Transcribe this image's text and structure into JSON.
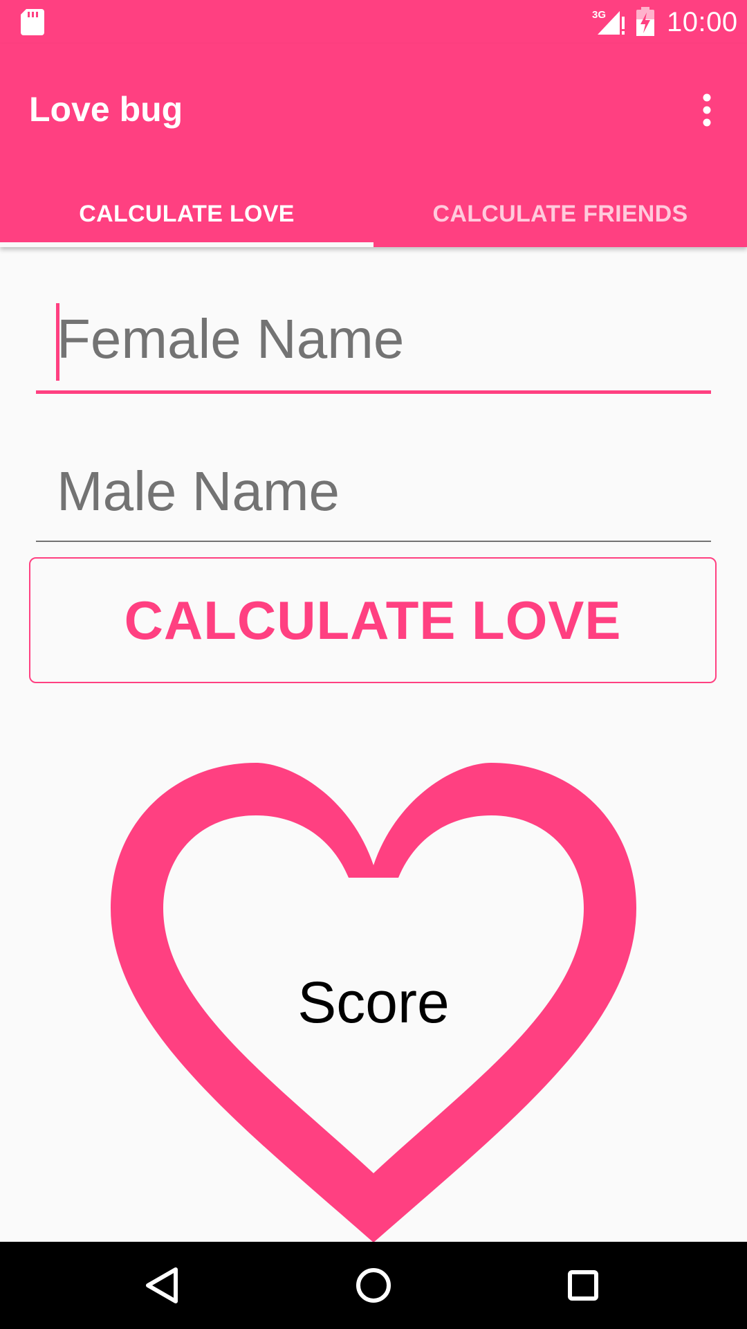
{
  "status_bar": {
    "time": "10:00",
    "network": "3G",
    "icons": [
      "sd-card-icon",
      "signal-icon",
      "battery-charging-icon"
    ]
  },
  "app_bar": {
    "title": "Love bug",
    "menu_icon": "more-vert-icon"
  },
  "tabs": [
    {
      "label": "CALCULATE LOVE",
      "selected": true
    },
    {
      "label": "CALCULATE FRIENDS",
      "selected": false
    }
  ],
  "form": {
    "female_placeholder": "Female Name",
    "female_value": "",
    "male_placeholder": "Male Name",
    "male_value": "",
    "button_label": "CALCULATE LOVE"
  },
  "result": {
    "label": "Score",
    "icon": "heart-outline-icon"
  },
  "nav_bar": {
    "icons": [
      "back-icon",
      "home-icon",
      "recents-icon"
    ]
  },
  "colors": {
    "accent": "#ff4081",
    "background": "#fafafa",
    "hint_text": "#737373"
  }
}
